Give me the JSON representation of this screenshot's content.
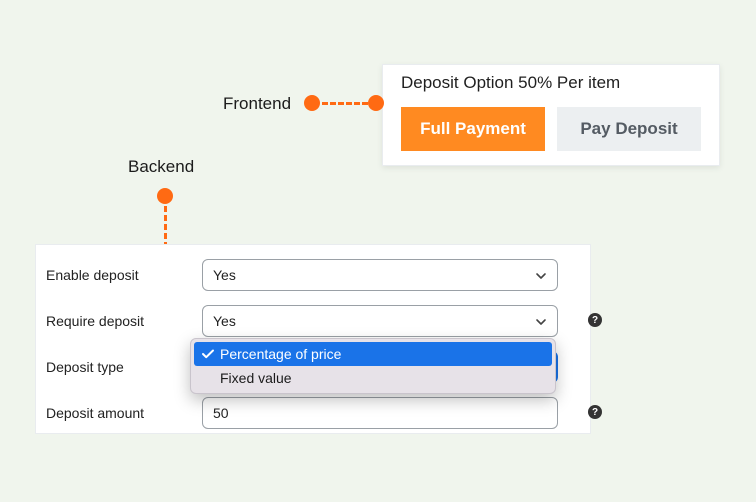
{
  "labels": {
    "frontend": "Frontend",
    "backend": "Backend"
  },
  "frontend": {
    "title": "Deposit Option 50% Per item",
    "full_payment": "Full Payment",
    "pay_deposit": "Pay Deposit"
  },
  "backend": {
    "enable_deposit": {
      "label": "Enable deposit",
      "value": "Yes"
    },
    "require_deposit": {
      "label": "Require deposit",
      "value": "Yes"
    },
    "deposit_type": {
      "label": "Deposit type",
      "options": {
        "percentage": "Percentage of price",
        "fixed": "Fixed value"
      }
    },
    "deposit_amount": {
      "label": "Deposit amount",
      "value": "50"
    }
  }
}
